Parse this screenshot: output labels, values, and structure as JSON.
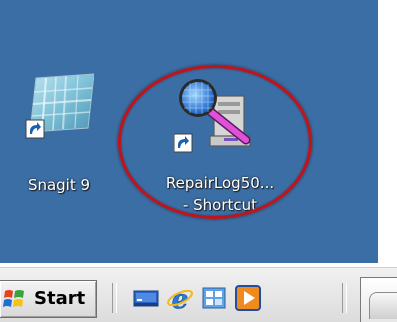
{
  "desktop": {
    "icons": [
      {
        "name": "snagit",
        "label": "Snagit 9"
      },
      {
        "name": "repairlog",
        "label_line1": "RepairLog50...",
        "label_line2": "- Shortcut"
      }
    ]
  },
  "taskbar": {
    "start_label": "Start",
    "quick_launch": [
      {
        "icon": "show-desktop-icon"
      },
      {
        "icon": "internet-explorer-icon"
      },
      {
        "icon": "switch-windows-icon"
      },
      {
        "icon": "media-player-icon"
      }
    ]
  },
  "colors": {
    "desktop_background": "#3a6ea5",
    "highlight_circle": "#c0141b",
    "label_text": "#ffffff"
  }
}
